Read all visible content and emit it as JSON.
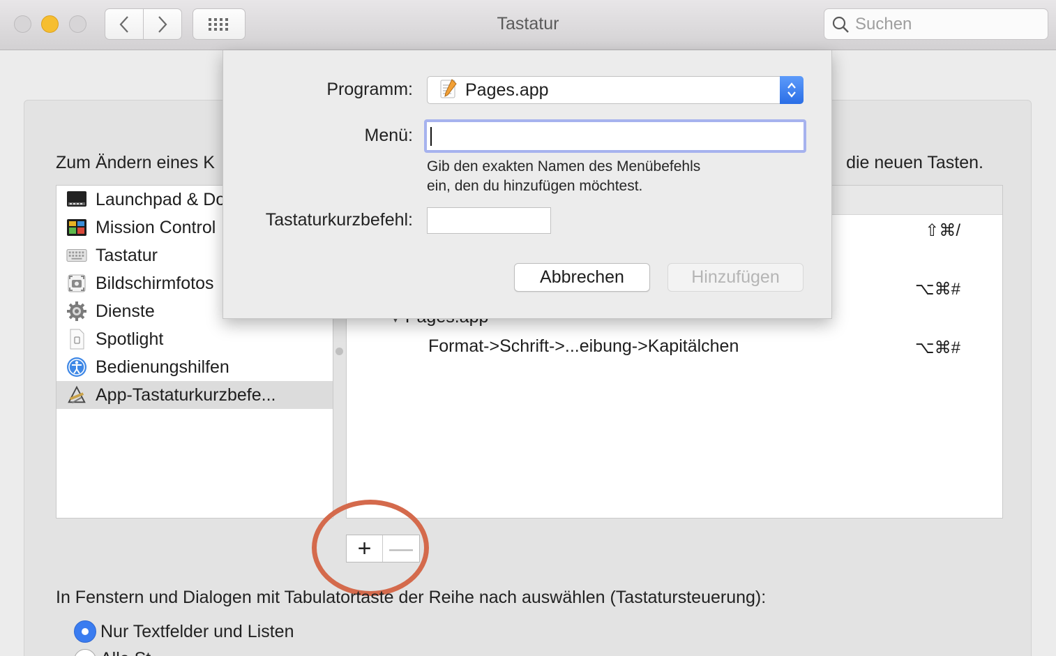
{
  "window": {
    "title": "Tastatur",
    "search_placeholder": "Suchen"
  },
  "instructions": {
    "left": "Zum Ändern eines K",
    "right": "die neuen Tasten."
  },
  "sidebar": {
    "items": [
      {
        "label": "Launchpad & Dock",
        "icon": "launchpad-dock-icon"
      },
      {
        "label": "Mission Control",
        "icon": "mission-control-icon"
      },
      {
        "label": "Tastatur",
        "icon": "keyboard-icon"
      },
      {
        "label": "Bildschirmfotos",
        "icon": "screenshot-icon"
      },
      {
        "label": "Dienste",
        "icon": "services-gear-icon"
      },
      {
        "label": "Spotlight",
        "icon": "spotlight-document-icon"
      },
      {
        "label": "Bedienungshilfen",
        "icon": "accessibility-icon"
      },
      {
        "label": "App-Tastaturkurzbefe...",
        "icon": "app-shortcuts-icon",
        "selected": true
      }
    ]
  },
  "shortcuts": {
    "rows": [
      {
        "label": "",
        "shortcut": "⇧⌘/"
      },
      {
        "label": "",
        "shortcut": "⌥⌘#"
      },
      {
        "label": "Pages.app",
        "shortcut": ""
      },
      {
        "label": "Format->Schrift->...eibung->Kapitälchen",
        "shortcut": "⌥⌘#"
      }
    ]
  },
  "buttons": {
    "plus": "+",
    "minus": "—"
  },
  "tab_navigation": {
    "label": "In Fenstern und Dialogen mit Tabulatortaste der Reihe nach auswählen (Tastatursteuerung):",
    "option1": "Nur Textfelder und Listen",
    "option2": "Alle St"
  },
  "dialog": {
    "program_label": "Programm:",
    "program_value": "Pages.app",
    "menu_label": "Menü:",
    "menu_value": "",
    "hint": "Gib den exakten Namen des Menübefehls ein, den du hinzufügen möchtest.",
    "hint_line1": "Gib den exakten Namen des Menübefehls",
    "hint_line2": "ein, den du hinzufügen möchtest.",
    "shortcut_label": "Tastaturkurzbefehl:",
    "cancel": "Abbrechen",
    "add": "Hinzufügen"
  },
  "colors": {
    "accent": "#3a7cf0",
    "highlight_circle": "#d46a4c",
    "focus_ring": "#a6b2ee"
  }
}
